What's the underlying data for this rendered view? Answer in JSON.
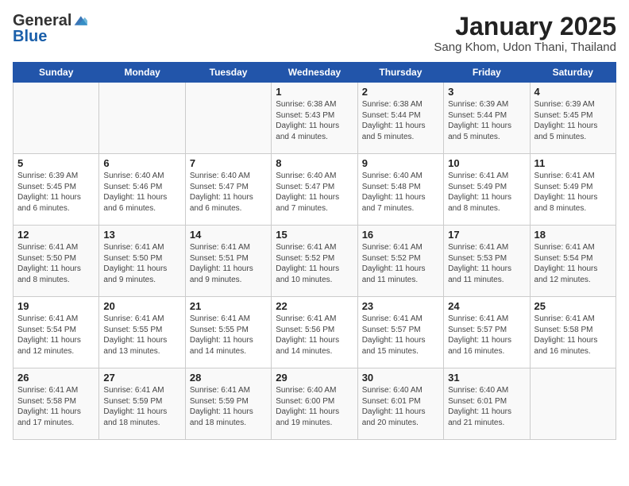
{
  "header": {
    "logo_general": "General",
    "logo_blue": "Blue",
    "title": "January 2025",
    "subtitle": "Sang Khom, Udon Thani, Thailand"
  },
  "days_of_week": [
    "Sunday",
    "Monday",
    "Tuesday",
    "Wednesday",
    "Thursday",
    "Friday",
    "Saturday"
  ],
  "weeks": [
    [
      {
        "day": "",
        "info": ""
      },
      {
        "day": "",
        "info": ""
      },
      {
        "day": "",
        "info": ""
      },
      {
        "day": "1",
        "info": "Sunrise: 6:38 AM\nSunset: 5:43 PM\nDaylight: 11 hours\nand 4 minutes."
      },
      {
        "day": "2",
        "info": "Sunrise: 6:38 AM\nSunset: 5:44 PM\nDaylight: 11 hours\nand 5 minutes."
      },
      {
        "day": "3",
        "info": "Sunrise: 6:39 AM\nSunset: 5:44 PM\nDaylight: 11 hours\nand 5 minutes."
      },
      {
        "day": "4",
        "info": "Sunrise: 6:39 AM\nSunset: 5:45 PM\nDaylight: 11 hours\nand 5 minutes."
      }
    ],
    [
      {
        "day": "5",
        "info": "Sunrise: 6:39 AM\nSunset: 5:45 PM\nDaylight: 11 hours\nand 6 minutes."
      },
      {
        "day": "6",
        "info": "Sunrise: 6:40 AM\nSunset: 5:46 PM\nDaylight: 11 hours\nand 6 minutes."
      },
      {
        "day": "7",
        "info": "Sunrise: 6:40 AM\nSunset: 5:47 PM\nDaylight: 11 hours\nand 6 minutes."
      },
      {
        "day": "8",
        "info": "Sunrise: 6:40 AM\nSunset: 5:47 PM\nDaylight: 11 hours\nand 7 minutes."
      },
      {
        "day": "9",
        "info": "Sunrise: 6:40 AM\nSunset: 5:48 PM\nDaylight: 11 hours\nand 7 minutes."
      },
      {
        "day": "10",
        "info": "Sunrise: 6:41 AM\nSunset: 5:49 PM\nDaylight: 11 hours\nand 8 minutes."
      },
      {
        "day": "11",
        "info": "Sunrise: 6:41 AM\nSunset: 5:49 PM\nDaylight: 11 hours\nand 8 minutes."
      }
    ],
    [
      {
        "day": "12",
        "info": "Sunrise: 6:41 AM\nSunset: 5:50 PM\nDaylight: 11 hours\nand 8 minutes."
      },
      {
        "day": "13",
        "info": "Sunrise: 6:41 AM\nSunset: 5:50 PM\nDaylight: 11 hours\nand 9 minutes."
      },
      {
        "day": "14",
        "info": "Sunrise: 6:41 AM\nSunset: 5:51 PM\nDaylight: 11 hours\nand 9 minutes."
      },
      {
        "day": "15",
        "info": "Sunrise: 6:41 AM\nSunset: 5:52 PM\nDaylight: 11 hours\nand 10 minutes."
      },
      {
        "day": "16",
        "info": "Sunrise: 6:41 AM\nSunset: 5:52 PM\nDaylight: 11 hours\nand 11 minutes."
      },
      {
        "day": "17",
        "info": "Sunrise: 6:41 AM\nSunset: 5:53 PM\nDaylight: 11 hours\nand 11 minutes."
      },
      {
        "day": "18",
        "info": "Sunrise: 6:41 AM\nSunset: 5:54 PM\nDaylight: 11 hours\nand 12 minutes."
      }
    ],
    [
      {
        "day": "19",
        "info": "Sunrise: 6:41 AM\nSunset: 5:54 PM\nDaylight: 11 hours\nand 12 minutes."
      },
      {
        "day": "20",
        "info": "Sunrise: 6:41 AM\nSunset: 5:55 PM\nDaylight: 11 hours\nand 13 minutes."
      },
      {
        "day": "21",
        "info": "Sunrise: 6:41 AM\nSunset: 5:55 PM\nDaylight: 11 hours\nand 14 minutes."
      },
      {
        "day": "22",
        "info": "Sunrise: 6:41 AM\nSunset: 5:56 PM\nDaylight: 11 hours\nand 14 minutes."
      },
      {
        "day": "23",
        "info": "Sunrise: 6:41 AM\nSunset: 5:57 PM\nDaylight: 11 hours\nand 15 minutes."
      },
      {
        "day": "24",
        "info": "Sunrise: 6:41 AM\nSunset: 5:57 PM\nDaylight: 11 hours\nand 16 minutes."
      },
      {
        "day": "25",
        "info": "Sunrise: 6:41 AM\nSunset: 5:58 PM\nDaylight: 11 hours\nand 16 minutes."
      }
    ],
    [
      {
        "day": "26",
        "info": "Sunrise: 6:41 AM\nSunset: 5:58 PM\nDaylight: 11 hours\nand 17 minutes."
      },
      {
        "day": "27",
        "info": "Sunrise: 6:41 AM\nSunset: 5:59 PM\nDaylight: 11 hours\nand 18 minutes."
      },
      {
        "day": "28",
        "info": "Sunrise: 6:41 AM\nSunset: 5:59 PM\nDaylight: 11 hours\nand 18 minutes."
      },
      {
        "day": "29",
        "info": "Sunrise: 6:40 AM\nSunset: 6:00 PM\nDaylight: 11 hours\nand 19 minutes."
      },
      {
        "day": "30",
        "info": "Sunrise: 6:40 AM\nSunset: 6:01 PM\nDaylight: 11 hours\nand 20 minutes."
      },
      {
        "day": "31",
        "info": "Sunrise: 6:40 AM\nSunset: 6:01 PM\nDaylight: 11 hours\nand 21 minutes."
      },
      {
        "day": "",
        "info": ""
      }
    ]
  ]
}
